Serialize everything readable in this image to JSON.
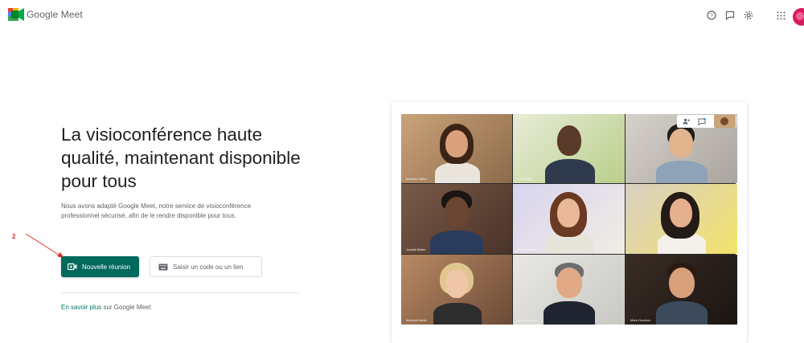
{
  "header": {
    "app_name": "Google Meet",
    "icons": [
      "help-icon",
      "feedback-icon",
      "settings-icon",
      "apps-grid-icon"
    ]
  },
  "hero": {
    "headline": "La visioconférence haute qualité, maintenant disponible pour tous",
    "description": "Nous avons adapté Google Meet, notre service de visioconférence professionnel sécurisé, afin de le rendre disponible pour tous."
  },
  "annotation": {
    "step": "2",
    "color": "#d93025"
  },
  "actions": {
    "new_meeting_label": "Nouvelle réunion",
    "code_placeholder": "Saisir un code ou un lien"
  },
  "learn_more": {
    "link_text": "En savoir plus",
    "suffix": " sur Google Meet"
  },
  "colors": {
    "accent": "#00695c",
    "link": "#00796b"
  },
  "video_grid": {
    "participants": [
      "Mariana Vieira",
      "Eli Phelps",
      "",
      "Juanita Baker",
      "Ava Williams",
      "",
      "Marissa Noble",
      "Ian Anderson",
      "Mark Houston"
    ]
  }
}
